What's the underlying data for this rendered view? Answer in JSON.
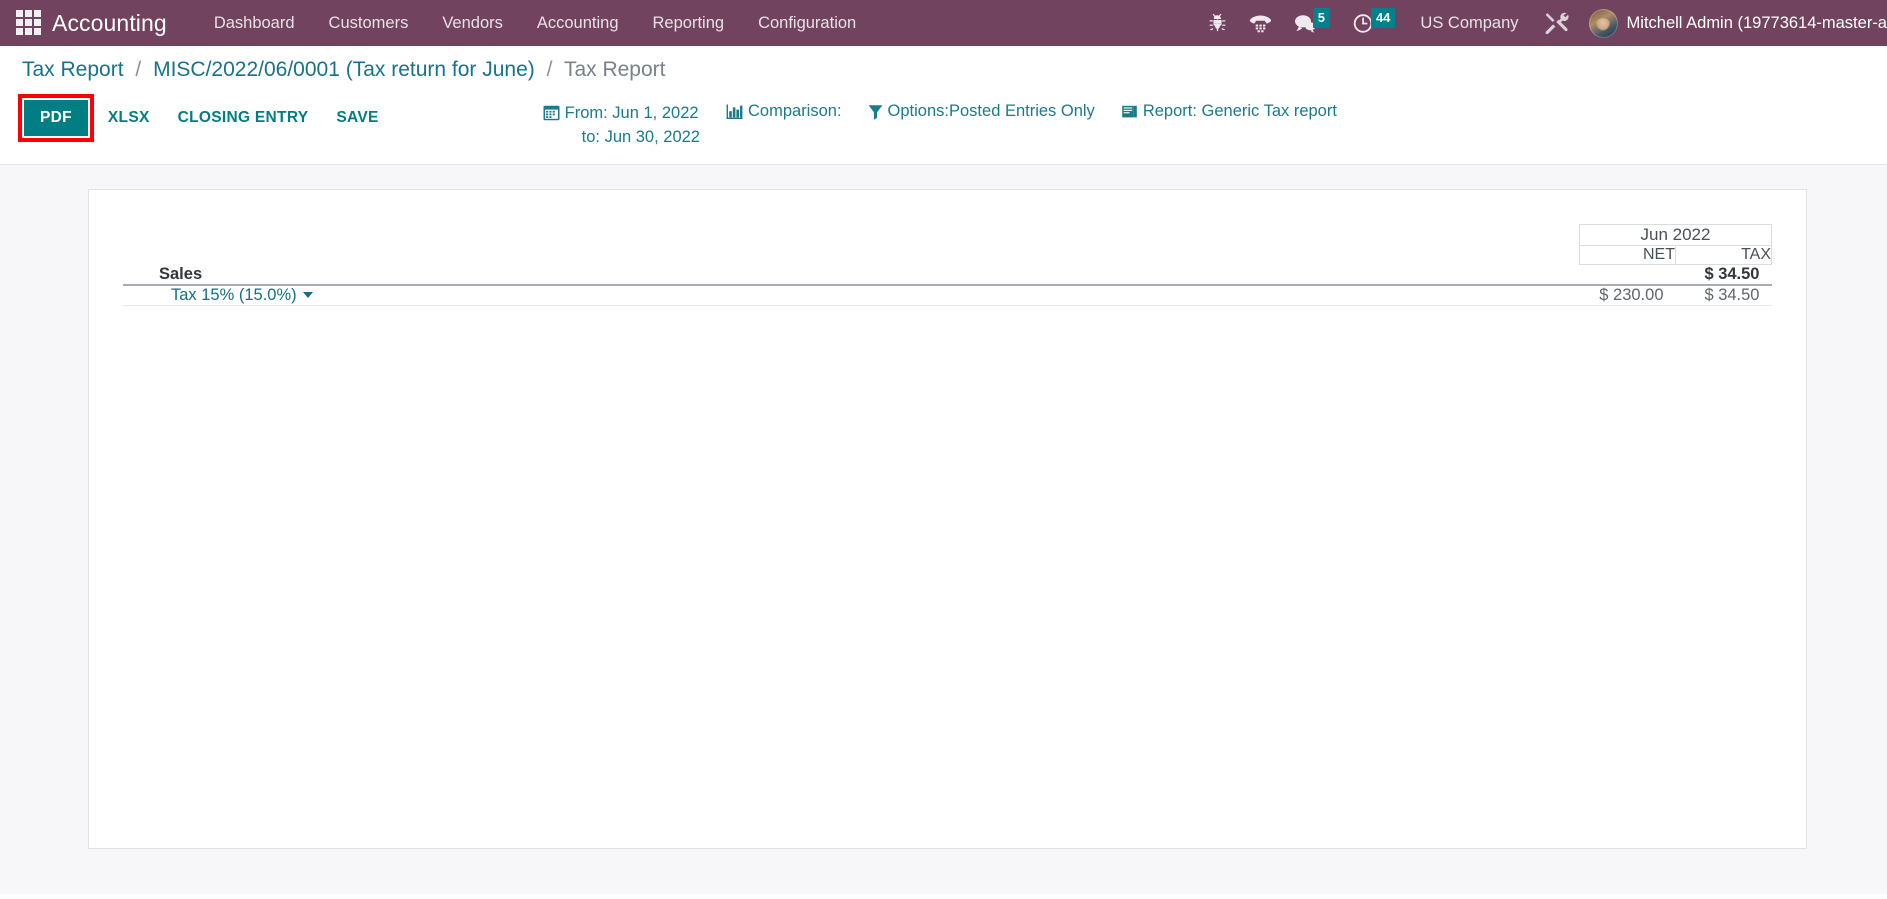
{
  "navbar": {
    "apps_icon": "apps-grid-icon",
    "brand": "Accounting",
    "menu_items": [
      {
        "label": "Dashboard"
      },
      {
        "label": "Customers"
      },
      {
        "label": "Vendors"
      },
      {
        "label": "Accounting"
      },
      {
        "label": "Reporting"
      },
      {
        "label": "Configuration"
      }
    ],
    "systray": {
      "bug_icon": "bug-icon",
      "phone_icon": "phone-dialpad-icon",
      "messages_icon": "chat-bubble-icon",
      "messages_count": "5",
      "activities_icon": "clock-icon",
      "activities_count": "44",
      "company": "US Company",
      "tools_icon": "tools-icon",
      "user_name": "Mitchell Admin (19773614-master-a"
    },
    "colors": {
      "bar_bg": "#71435f",
      "badge_bg": "#00828e",
      "text": "#e7e1e6"
    }
  },
  "breadcrumb": {
    "root": "Tax Report",
    "parent": "MISC/2022/06/0001 (Tax return for June)",
    "current": "Tax Report",
    "separator": "/"
  },
  "toolbar": {
    "pdf_label": "PDF",
    "xlsx_label": "XLSX",
    "closing_entry_label": "CLOSING ENTRY",
    "save_label": "SAVE",
    "highlight_color": "#fb0007",
    "primary_color": "#017e84"
  },
  "filters": {
    "date_icon": "calendar-icon",
    "date_from": "From: Jun 1, 2022",
    "date_to": "to: Jun 30, 2022",
    "comparison_icon": "bar-chart-icon",
    "comparison_label": "Comparison:",
    "options_icon": "filter-icon",
    "options_label": "Options:Posted Entries Only",
    "report_icon": "book-icon",
    "report_label": "Report: Generic Tax report"
  },
  "report": {
    "period_header": "Jun 2022",
    "sub_headers": [
      "NET",
      "TAX"
    ],
    "rows": [
      {
        "type": "section",
        "label": "Sales",
        "net": "",
        "tax": "$ 34.50"
      },
      {
        "type": "line",
        "label": "Tax 15% (15.0%)",
        "net": "$ 230.00",
        "tax": "$ 34.50",
        "has_caret": true
      }
    ]
  }
}
